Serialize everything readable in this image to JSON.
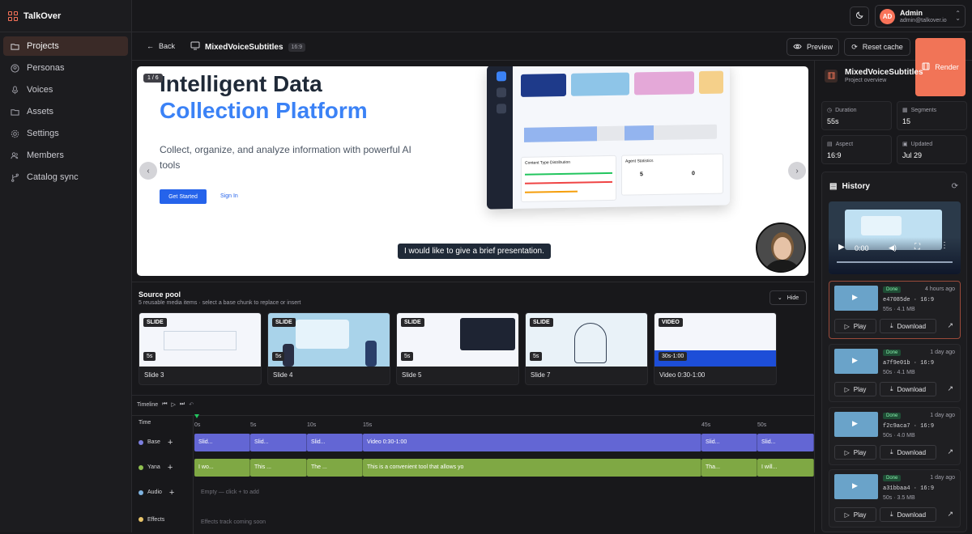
{
  "app": {
    "name": "TalkOver"
  },
  "sidebar": {
    "items": [
      {
        "label": "Projects",
        "icon": "folder-icon",
        "active": true
      },
      {
        "label": "Personas",
        "icon": "user-circle-icon"
      },
      {
        "label": "Voices",
        "icon": "microphone-icon"
      },
      {
        "label": "Assets",
        "icon": "folder-open-icon"
      },
      {
        "label": "Settings",
        "icon": "gear-icon"
      },
      {
        "label": "Members",
        "icon": "users-icon"
      },
      {
        "label": "Catalog sync",
        "icon": "branch-icon"
      }
    ]
  },
  "user": {
    "initials": "AD",
    "name": "Admin",
    "email": "admin@talkover.io"
  },
  "subbar": {
    "back": "Back",
    "title": "MixedVoiceSubtitles",
    "aspect": "16:9",
    "preview": "Preview",
    "reset_cache": "Reset cache",
    "render": "Render"
  },
  "stage": {
    "counter": "1 / 6",
    "heading_line1": "Intelligent Data",
    "heading_line2": "Collection Platform",
    "subtitle": "Collect, organize, and analyze information with powerful AI tools",
    "cta_primary": "Get Started",
    "cta_secondary": "Sign In",
    "caption": "I would like to give a brief presentation.",
    "mock_panel1": "Content Type Distribution",
    "mock_panel2": "Agent Statistics",
    "mock_stat1": "5",
    "mock_stat2": "0"
  },
  "pool": {
    "title": "Source pool",
    "subtitle": "5 reusable media items · select a base chunk to replace or insert",
    "hide": "Hide",
    "items": [
      {
        "tag": "SLIDE",
        "duration": "5s",
        "label": "Slide 3"
      },
      {
        "tag": "SLIDE",
        "duration": "5s",
        "label": "Slide 4"
      },
      {
        "tag": "SLIDE",
        "duration": "5s",
        "label": "Slide 5"
      },
      {
        "tag": "SLIDE",
        "duration": "5s",
        "label": "Slide 7"
      },
      {
        "tag": "VIDEO",
        "duration": "30s-1:00",
        "label": "Video 0:30-1:00"
      }
    ]
  },
  "timeline": {
    "title": "Timeline",
    "time_label": "Time",
    "ticks": [
      "0s",
      "5s",
      "10s",
      "15s",
      "45s",
      "50s"
    ],
    "tracks": [
      {
        "name": "Base",
        "color": "#7c7fe0"
      },
      {
        "name": "Yana",
        "color": "#8fbf4f"
      },
      {
        "name": "Audio",
        "color": "#7fb3e0"
      },
      {
        "name": "Effects",
        "color": "#e8c46a"
      }
    ],
    "base_clips": [
      "Slid...",
      "Slid...",
      "Slid...",
      "Video 0:30-1:00",
      "Slid...",
      "Slid..."
    ],
    "voice_clips": [
      "I wo...",
      "This ...",
      "The ...",
      "This is a convenient tool that allows yo",
      "Tha...",
      "I will..."
    ],
    "audio_empty": "Empty — click + to add",
    "effects_empty": "Effects track coming soon"
  },
  "overview": {
    "title": "MixedVoiceSubtitles",
    "subtitle": "Project overview",
    "stats": [
      {
        "key": "Duration",
        "value": "55s"
      },
      {
        "key": "Segments",
        "value": "15"
      },
      {
        "key": "Aspect",
        "value": "16:9"
      },
      {
        "key": "Updated",
        "value": "Jul 29"
      }
    ]
  },
  "history": {
    "title": "History",
    "player_time": "0:00",
    "renders": [
      {
        "status": "Done",
        "ago": "4 hours ago",
        "id": "e47085de",
        "aspect": "16:9",
        "meta": "55s · 4.1 MB"
      },
      {
        "status": "Done",
        "ago": "1 day ago",
        "id": "a7f9e01b",
        "aspect": "16:9",
        "meta": "50s · 4.1 MB"
      },
      {
        "status": "Done",
        "ago": "1 day ago",
        "id": "f2c9aca7",
        "aspect": "16:9",
        "meta": "50s · 4.0 MB"
      },
      {
        "status": "Done",
        "ago": "1 day ago",
        "id": "a31bbaa4",
        "aspect": "16:9",
        "meta": "50s · 3.5 MB"
      }
    ],
    "play": "Play",
    "download": "Download"
  }
}
